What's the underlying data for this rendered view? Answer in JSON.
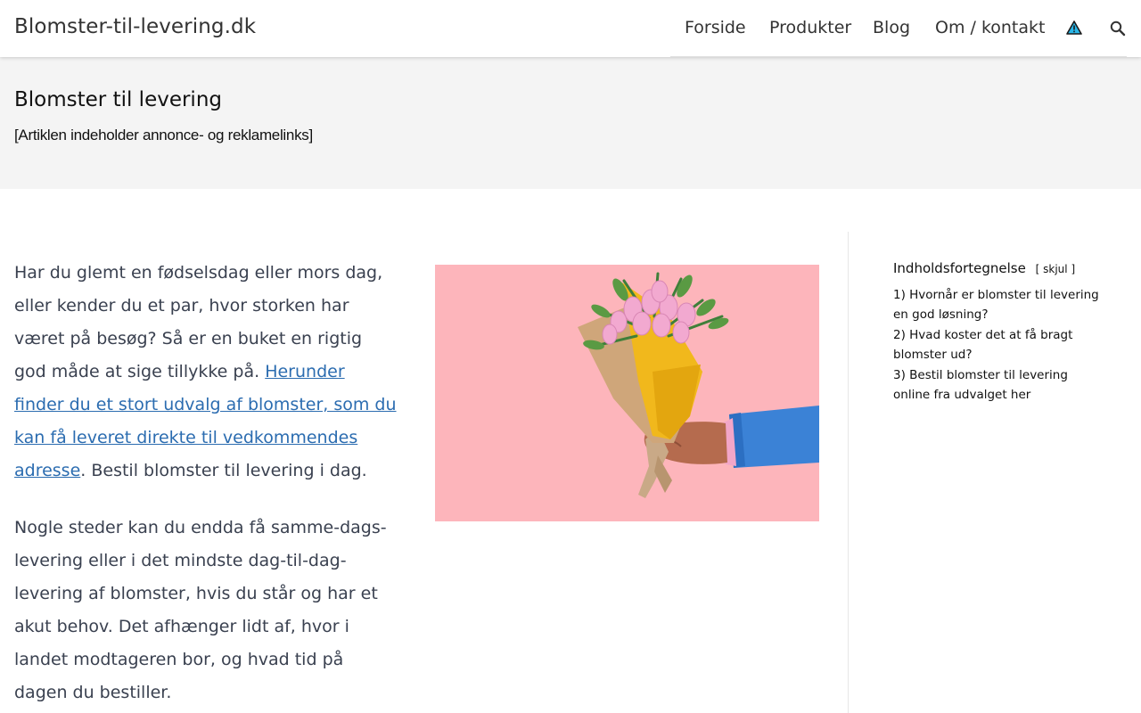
{
  "header": {
    "site_title": "Blomster-til-levering.dk",
    "nav": {
      "forside": "Forside",
      "produkter": "Produkter",
      "blog": "Blog",
      "om": "Om / kontakt"
    }
  },
  "hero": {
    "title": "Blomster til levering",
    "note": "[Artiklen indeholder annonce- og reklamelinks]"
  },
  "article": {
    "p1_before": "Har du glemt en fødselsdag eller mors dag, eller kender du et par, hvor storken har været på besøg? Så er en buket en rigtig god måde at sige tillykke på. ",
    "p1_link": "Herunder finder du et stort udvalg af blomster, som du kan få leveret direkte til vedkommendes adresse",
    "p1_after": ". Bestil blomster til levering i dag.",
    "p2": "Nogle steder kan du endda få samme-dags-levering eller i det mindste dag-til-dag-levering af blomster, hvis du står og har et akut behov. Det afhænger lidt af, hvor i landet modtageren bor, og hvad tid på dagen du bestiller."
  },
  "toc": {
    "title": "Indholdsfortegnelse",
    "toggle_open": "[",
    "toggle_label": "skjul",
    "toggle_close": "]",
    "items": [
      {
        "num": "1)",
        "label": "Hvornår er blomster til levering en god løsning?"
      },
      {
        "num": "2)",
        "label": "Hvad koster det at få bragt blomster ud?"
      },
      {
        "num": "3)",
        "label": "Bestil blomster til levering online fra udvalget her"
      }
    ]
  },
  "colors": {
    "link": "#2b6cb0",
    "image_background": "#fdb5bb",
    "hero_background": "#f4f4f4"
  },
  "icons": {
    "warning": "warning-triangle-icon",
    "search": "search-icon"
  }
}
